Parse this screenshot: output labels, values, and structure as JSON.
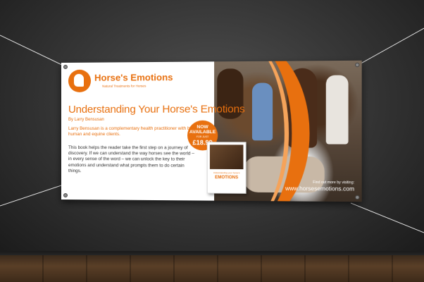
{
  "banner": {
    "brand": "Horse's Emotions",
    "tagline": "Natural Treatments for Horses",
    "title": "Understanding Your Horse's Emotions",
    "author": "By Larry Bensusan",
    "intro": "Larry Bensusan is a complementary health practitioner with both human and equine clients.",
    "description": "This book helps the reader take the first step on a journey of discovery. If we can understand the way horses see the world – in every sense of the word – we can unlock the key to their emotions and understand what prompts them to do certain things.",
    "badge": {
      "line1": "NOW",
      "line2": "AVAILABLE",
      "line3": "FOR JUST",
      "price": "£18.99"
    },
    "book": {
      "subtitle": "Understanding your horse's",
      "title": "EMOTIONS"
    },
    "find_out": "Find out more by visiting:",
    "url": "www.horsesemotions.com"
  },
  "colors": {
    "accent": "#e8700f",
    "wall": "#333333",
    "floor": "#5a3f27"
  }
}
